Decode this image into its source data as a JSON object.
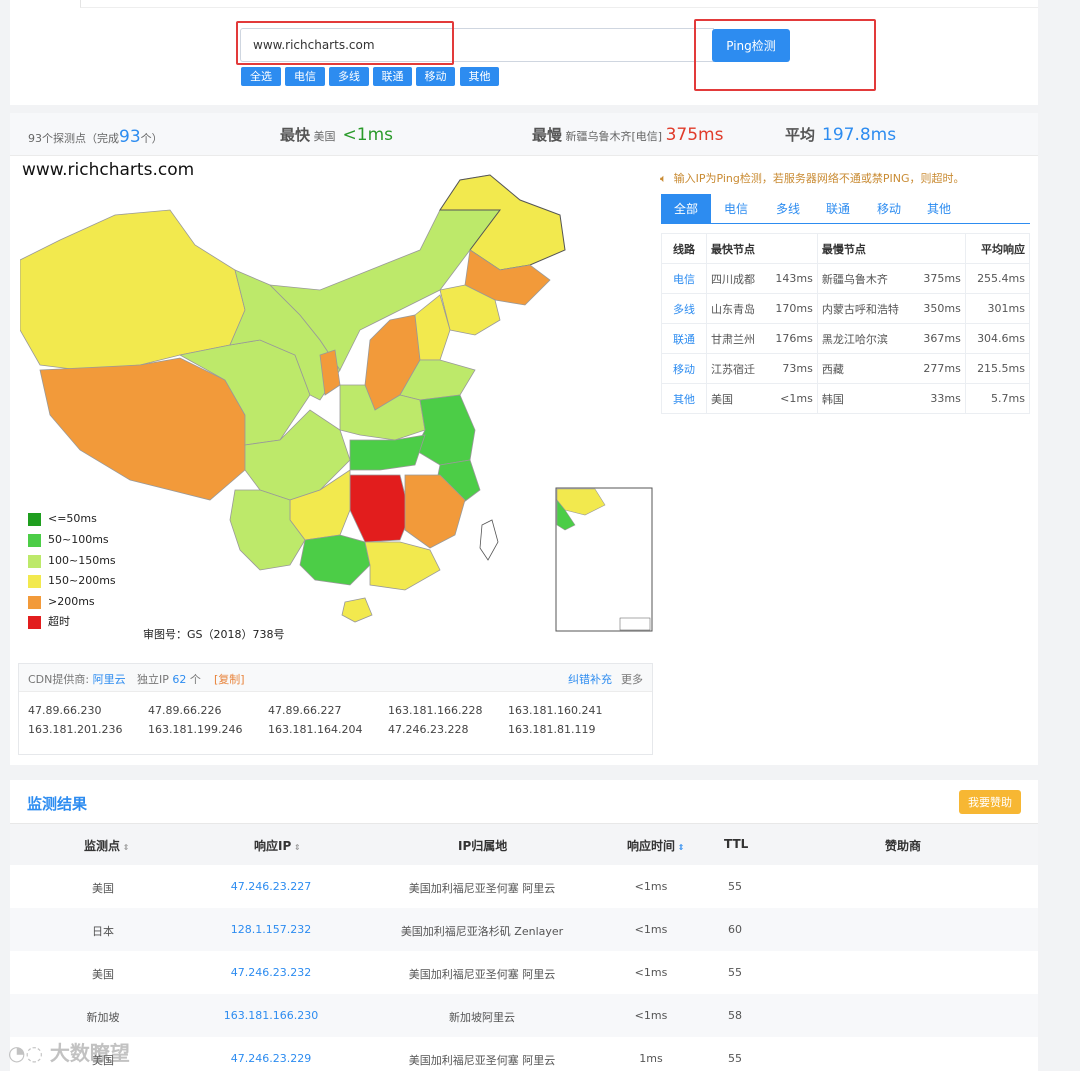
{
  "search": {
    "value": "www.richcharts.com",
    "button_label": "Ping检测"
  },
  "filters": [
    "全选",
    "电信",
    "多线",
    "联通",
    "移动",
    "其他"
  ],
  "stats": {
    "probe_count_text": "93个探测点（完成",
    "completed": "93",
    "completed_suffix": "个）",
    "fastest_label": "最快",
    "fastest_location": "美国",
    "fastest_value": "<1ms",
    "slowest_label": "最慢",
    "slowest_location": "新疆乌鲁木齐[电信]",
    "slowest_value": "375ms",
    "average_label": "平均",
    "average_value": "197.8ms"
  },
  "map": {
    "watermark": "www.richcharts.com",
    "approval": "审图号：GS（2018）738号",
    "legend": [
      {
        "label": "<=50ms",
        "color": "#1f9e1f"
      },
      {
        "label": "50~100ms",
        "color": "#4ccd47"
      },
      {
        "label": "100~150ms",
        "color": "#bde96a"
      },
      {
        "label": "150~200ms",
        "color": "#f2e94e"
      },
      {
        "label": ">200ms",
        "color": "#f29a3a"
      },
      {
        "label": "超时",
        "color": "#e21d1d"
      }
    ]
  },
  "notice": "输入IP为Ping检测，若服务器网络不通或禁PING，则超时。",
  "line_tabs": [
    "全部",
    "电信",
    "多线",
    "联通",
    "移动",
    "其他"
  ],
  "line_table": {
    "headers": [
      "线路",
      "最快节点",
      "最慢节点",
      "平均响应"
    ],
    "rows": [
      {
        "line": "电信",
        "fast_node": "四川成都",
        "fast_ms": "143ms",
        "slow_node": "新疆乌鲁木齐",
        "slow_ms": "375ms",
        "avg": "255.4ms"
      },
      {
        "line": "多线",
        "fast_node": "山东青岛",
        "fast_ms": "170ms",
        "slow_node": "内蒙古呼和浩特",
        "slow_ms": "350ms",
        "avg": "301ms"
      },
      {
        "line": "联通",
        "fast_node": "甘肃兰州",
        "fast_ms": "176ms",
        "slow_node": "黑龙江哈尔滨",
        "slow_ms": "367ms",
        "avg": "304.6ms"
      },
      {
        "line": "移动",
        "fast_node": "江苏宿迁",
        "fast_ms": "73ms",
        "slow_node": "西藏",
        "slow_ms": "277ms",
        "avg": "215.5ms"
      },
      {
        "line": "其他",
        "fast_node": "美国",
        "fast_ms": "<1ms",
        "slow_node": "韩国",
        "slow_ms": "33ms",
        "avg": "5.7ms"
      }
    ]
  },
  "cdn": {
    "provider_label": "CDN提供商:",
    "provider": "阿里云",
    "ip_label": "独立IP",
    "ip_count": "62",
    "ip_unit": "个",
    "copy_label": "[复制]",
    "correct_label": "纠错补充",
    "more_label": "更多",
    "ips": [
      "47.89.66.230",
      "47.89.66.226",
      "47.89.66.227",
      "163.181.166.228",
      "163.181.160.241",
      "163.181.201.236",
      "163.181.199.246",
      "163.181.164.204",
      "47.246.23.228",
      "163.181.81.119"
    ]
  },
  "results": {
    "title": "监测结果",
    "sponsor_button": "我要赞助",
    "headers": [
      "监测点",
      "响应IP",
      "IP归属地",
      "响应时间",
      "TTL",
      "赞助商"
    ],
    "rows": [
      {
        "point": "美国",
        "ip": "47.246.23.227",
        "location": "美国加利福尼亚圣何塞 阿里云",
        "time": "<1ms",
        "ttl": "55"
      },
      {
        "point": "日本",
        "ip": "128.1.157.232",
        "location": "美国加利福尼亚洛杉矶 Zenlayer",
        "time": "<1ms",
        "ttl": "60"
      },
      {
        "point": "美国",
        "ip": "47.246.23.232",
        "location": "美国加利福尼亚圣何塞 阿里云",
        "time": "<1ms",
        "ttl": "55"
      },
      {
        "point": "新加坡",
        "ip": "163.181.166.230",
        "location": "新加坡阿里云",
        "time": "<1ms",
        "ttl": "58"
      },
      {
        "point": "美国",
        "ip": "47.246.23.229",
        "location": "美国加利福尼亚圣何塞 阿里云",
        "time": "1ms",
        "ttl": "55"
      }
    ]
  },
  "watermark_bottom": "大数瞭望"
}
